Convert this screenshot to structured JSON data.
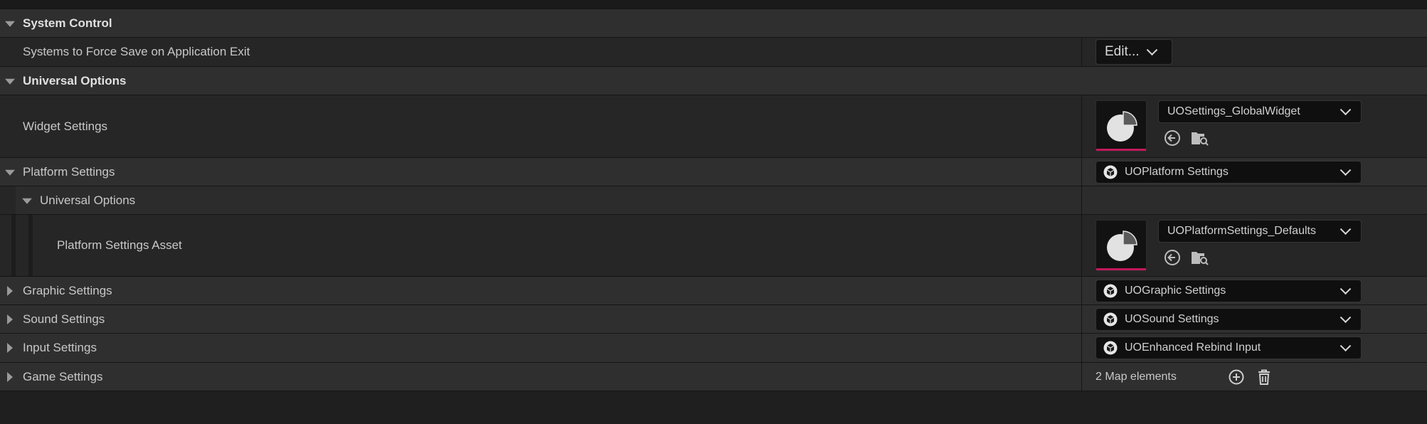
{
  "colors": {
    "background": "#1f1f1f",
    "category_row": "#2f2f2f",
    "property_row": "#262626",
    "combo_bg": "#0f0f0f",
    "thumbnail_accent": "#c2185b"
  },
  "rows": {
    "system_control": {
      "label": "System Control"
    },
    "systems_to_force_save": {
      "label": "Systems to Force Save on Application Exit",
      "button_label": "Edit..."
    },
    "universal_options": {
      "label": "Universal Options"
    },
    "widget_settings": {
      "label": "Widget Settings",
      "asset_value": "UOSettings_GlobalWidget"
    },
    "platform_settings": {
      "label": "Platform Settings",
      "class_value": "UOPlatform Settings"
    },
    "platform_universal_options": {
      "label": "Universal Options"
    },
    "platform_settings_asset": {
      "label": "Platform Settings Asset",
      "asset_value": "UOPlatformSettings_Defaults"
    },
    "graphic_settings": {
      "label": "Graphic Settings",
      "class_value": "UOGraphic Settings"
    },
    "sound_settings": {
      "label": "Sound Settings",
      "class_value": "UOSound Settings"
    },
    "input_settings": {
      "label": "Input Settings",
      "class_value": "UOEnhanced Rebind Input"
    },
    "game_settings": {
      "label": "Game Settings",
      "map_count": "2 Map elements"
    }
  },
  "icons": {
    "expanded": "triangle-down",
    "collapsed": "triangle-right",
    "thumbnail": "pie-chart-icon",
    "use_selected": "arrow-left-circle-icon",
    "browse": "folder-search-icon",
    "class": "cube-circle-icon",
    "add": "plus-circle-icon",
    "delete": "trash-icon"
  }
}
